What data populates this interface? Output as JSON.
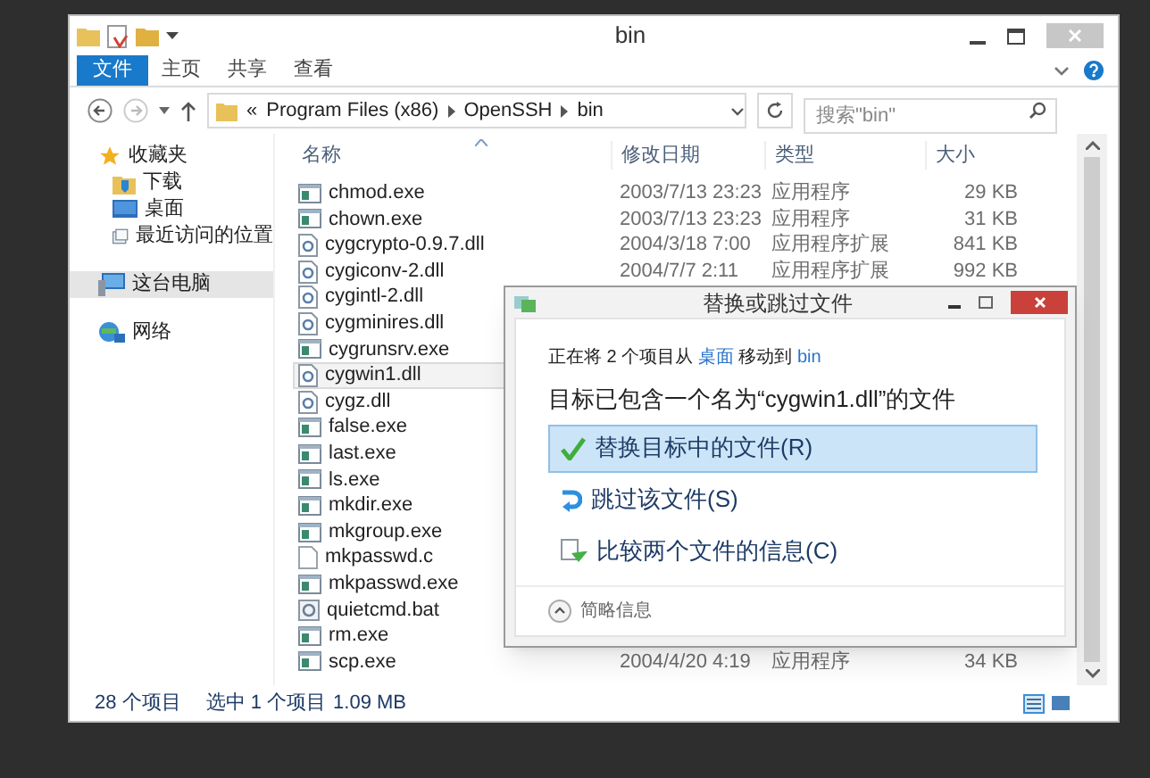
{
  "explorer": {
    "title": "bin",
    "ribbon_tabs": [
      {
        "label": "文件",
        "selected": true
      },
      {
        "label": "主页",
        "selected": false
      },
      {
        "label": "共享",
        "selected": false
      },
      {
        "label": "查看",
        "selected": false
      }
    ],
    "breadcrumb": [
      "«",
      "Program Files (x86)",
      "OpenSSH",
      "bin"
    ],
    "search": {
      "placeholder": "搜索\"bin\""
    },
    "nav": [
      {
        "label": "收藏夹",
        "selected": false,
        "children": [
          {
            "label": "下载",
            "selected": false
          },
          {
            "label": "桌面",
            "selected": false
          },
          {
            "label": "最近访问的位置",
            "selected": false
          }
        ]
      },
      {
        "label": "这台电脑",
        "selected": true
      },
      {
        "label": "网络",
        "selected": false
      }
    ],
    "columns": [
      "名称",
      "修改日期",
      "类型",
      "大小"
    ],
    "files": [
      {
        "name": "chmod.exe",
        "kind": "exe",
        "selected": false,
        "date": "2003/7/13 23:23",
        "type": "应用程序",
        "size": "29 KB"
      },
      {
        "name": "chown.exe",
        "kind": "exe",
        "selected": false,
        "date": "2003/7/13 23:23",
        "type": "应用程序",
        "size": "31 KB"
      },
      {
        "name": "cygcrypto-0.9.7.dll",
        "kind": "dll",
        "selected": false,
        "date": "2004/3/18 7:00",
        "type": "应用程序扩展",
        "size": "841 KB"
      },
      {
        "name": "cygiconv-2.dll",
        "kind": "dll",
        "selected": false,
        "date": "2004/7/7 2:11",
        "type": "应用程序扩展",
        "size": "992 KB"
      },
      {
        "name": "cygintl-2.dll",
        "kind": "dll",
        "selected": false
      },
      {
        "name": "cygminires.dll",
        "kind": "dll",
        "selected": false
      },
      {
        "name": "cygrunsrv.exe",
        "kind": "exe",
        "selected": false
      },
      {
        "name": "cygwin1.dll",
        "kind": "dll",
        "selected": true
      },
      {
        "name": "cygz.dll",
        "kind": "dll",
        "selected": false
      },
      {
        "name": "false.exe",
        "kind": "exe",
        "selected": false
      },
      {
        "name": "last.exe",
        "kind": "exe",
        "selected": false
      },
      {
        "name": "ls.exe",
        "kind": "exe",
        "selected": false
      },
      {
        "name": "mkdir.exe",
        "kind": "exe",
        "selected": false
      },
      {
        "name": "mkgroup.exe",
        "kind": "exe",
        "selected": false
      },
      {
        "name": "mkpasswd.c",
        "kind": "c",
        "selected": false
      },
      {
        "name": "mkpasswd.exe",
        "kind": "exe",
        "selected": false
      },
      {
        "name": "quietcmd.bat",
        "kind": "bat",
        "selected": false
      },
      {
        "name": "rm.exe",
        "kind": "exe",
        "selected": false
      },
      {
        "name": "scp.exe",
        "kind": "exe",
        "selected": false,
        "date": "2004/4/20 4:19",
        "type": "应用程序",
        "size": "34 KB"
      }
    ],
    "status_bar": {
      "count": "28 个项目",
      "selection": "选中 1 个项目",
      "size": "1.09 MB"
    }
  },
  "dialog": {
    "title": "替换或跳过文件",
    "message": [
      {
        "text": "正在将 2 个项目从 ",
        "link": false
      },
      {
        "text": "桌面",
        "link": true
      },
      {
        "text": " 移动到 ",
        "link": false
      },
      {
        "text": "bin",
        "link": true
      }
    ],
    "heading": "目标已包含一个名为“cygwin1.dll”的文件",
    "options": [
      {
        "label": "替换目标中的文件(R)",
        "kind": "replace",
        "selected": true
      },
      {
        "label": "跳过该文件(S)",
        "kind": "skip",
        "selected": false
      },
      {
        "label": "比较两个文件的信息(C)",
        "kind": "compare",
        "selected": false
      }
    ],
    "details_toggle": "简略信息"
  }
}
